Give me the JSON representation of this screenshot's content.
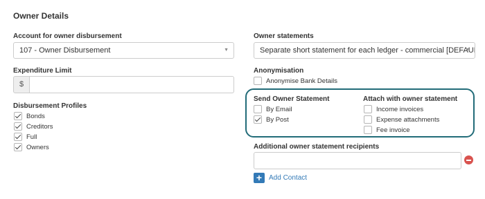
{
  "section": {
    "title": "Owner Details"
  },
  "left": {
    "disbursement": {
      "label": "Account for owner disbursement",
      "value": "107 - Owner Disbursement"
    },
    "expenditure": {
      "label": "Expenditure Limit",
      "prefix": "$",
      "value": ""
    },
    "profiles": {
      "label": "Disbursement Profiles",
      "items": [
        {
          "label": "Bonds",
          "checked": true
        },
        {
          "label": "Creditors",
          "checked": true
        },
        {
          "label": "Full",
          "checked": true
        },
        {
          "label": "Owners",
          "checked": true
        }
      ]
    }
  },
  "right": {
    "statements": {
      "label": "Owner statements",
      "value": "Separate short statement for each ledger - commercial [DEFAULT]"
    },
    "anonymisation": {
      "label": "Anonymisation",
      "option": "Anonymise Bank Details",
      "checked": false
    },
    "send": {
      "label": "Send Owner Statement",
      "items": [
        {
          "label": "By Email",
          "checked": false
        },
        {
          "label": "By Post",
          "checked": true
        }
      ]
    },
    "attach": {
      "label": "Attach with owner statement",
      "items": [
        {
          "label": "Income invoices",
          "checked": false
        },
        {
          "label": "Expense attachments",
          "checked": false
        },
        {
          "label": "Fee invoice",
          "checked": false
        }
      ]
    },
    "recipients": {
      "label": "Additional owner statement recipients",
      "value": ""
    },
    "add_contact": "Add Contact"
  },
  "colors": {
    "highlight": "#216b78",
    "link": "#337ab7",
    "danger": "#d9534f"
  },
  "icons": {
    "select_caret": "caret-down-icon",
    "check": "checkmark-icon",
    "add": "plus-icon",
    "remove": "minus-circle-icon"
  }
}
